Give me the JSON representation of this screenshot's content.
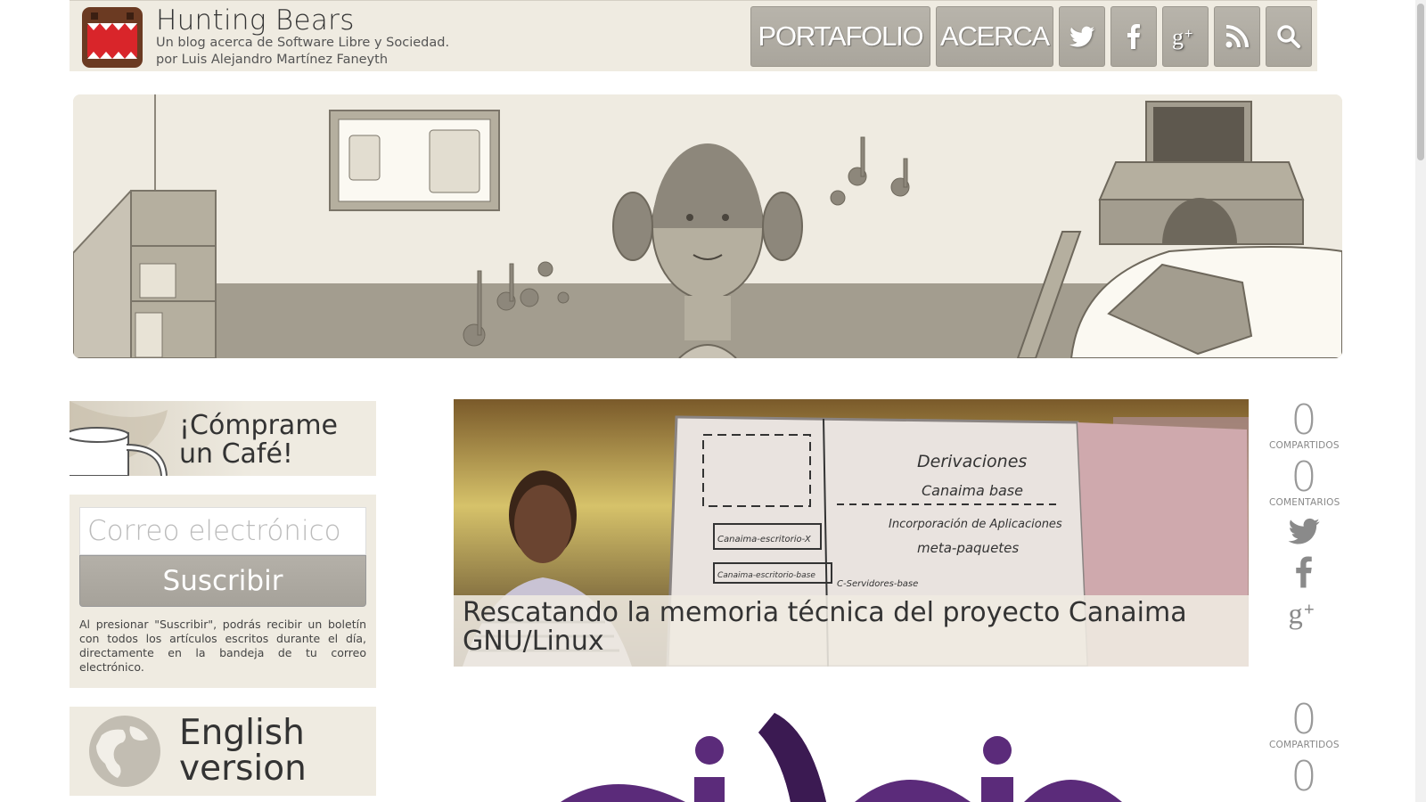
{
  "header": {
    "title": "Hunting Bears",
    "subtitle_line1": "Un blog acerca de Software Libre y Sociedad.",
    "subtitle_line2": "por Luis Alejandro Martínez Faneyth",
    "nav": {
      "portfolio_label": "PORTAFOLIO",
      "about_label": "ACERCA"
    },
    "icons": [
      "twitter-icon",
      "facebook-icon",
      "google-plus-icon",
      "rss-icon",
      "search-icon"
    ]
  },
  "sidebar": {
    "coffee_text": "¡Cómprame un Café!",
    "subscribe": {
      "email_placeholder": "Correo electrónico",
      "button_label": "Suscribir",
      "note": "Al presionar \"Suscribir\", podrás recibir un boletín con todos los artículos escritos durante el día, directamente en la bandeja de tu correo electrónico."
    },
    "english_text": "English version"
  },
  "posts": [
    {
      "title": "Rescatando la memoria técnica del proyecto Canaima GNU/Linux",
      "whiteboard_lines": [
        "Derivaciones",
        "Canaima base",
        "Incorporación de Aplicaciones",
        "meta-paquetes",
        "Canaima-escritorio-X",
        "Canaima-escritorio-base",
        "C-Servidores-base"
      ],
      "shares_count": "0",
      "shares_label": "COMPARTIDOS",
      "comments_count": "0",
      "comments_label": "COMENTARIOS"
    },
    {
      "shares_count": "0",
      "shares_label": "COMPARTIDOS",
      "comments_count": "0"
    }
  ],
  "colors": {
    "panel_bg": "#efebe1",
    "button_gray": "#aca89f",
    "post2_purple": "#5b2b7a"
  }
}
